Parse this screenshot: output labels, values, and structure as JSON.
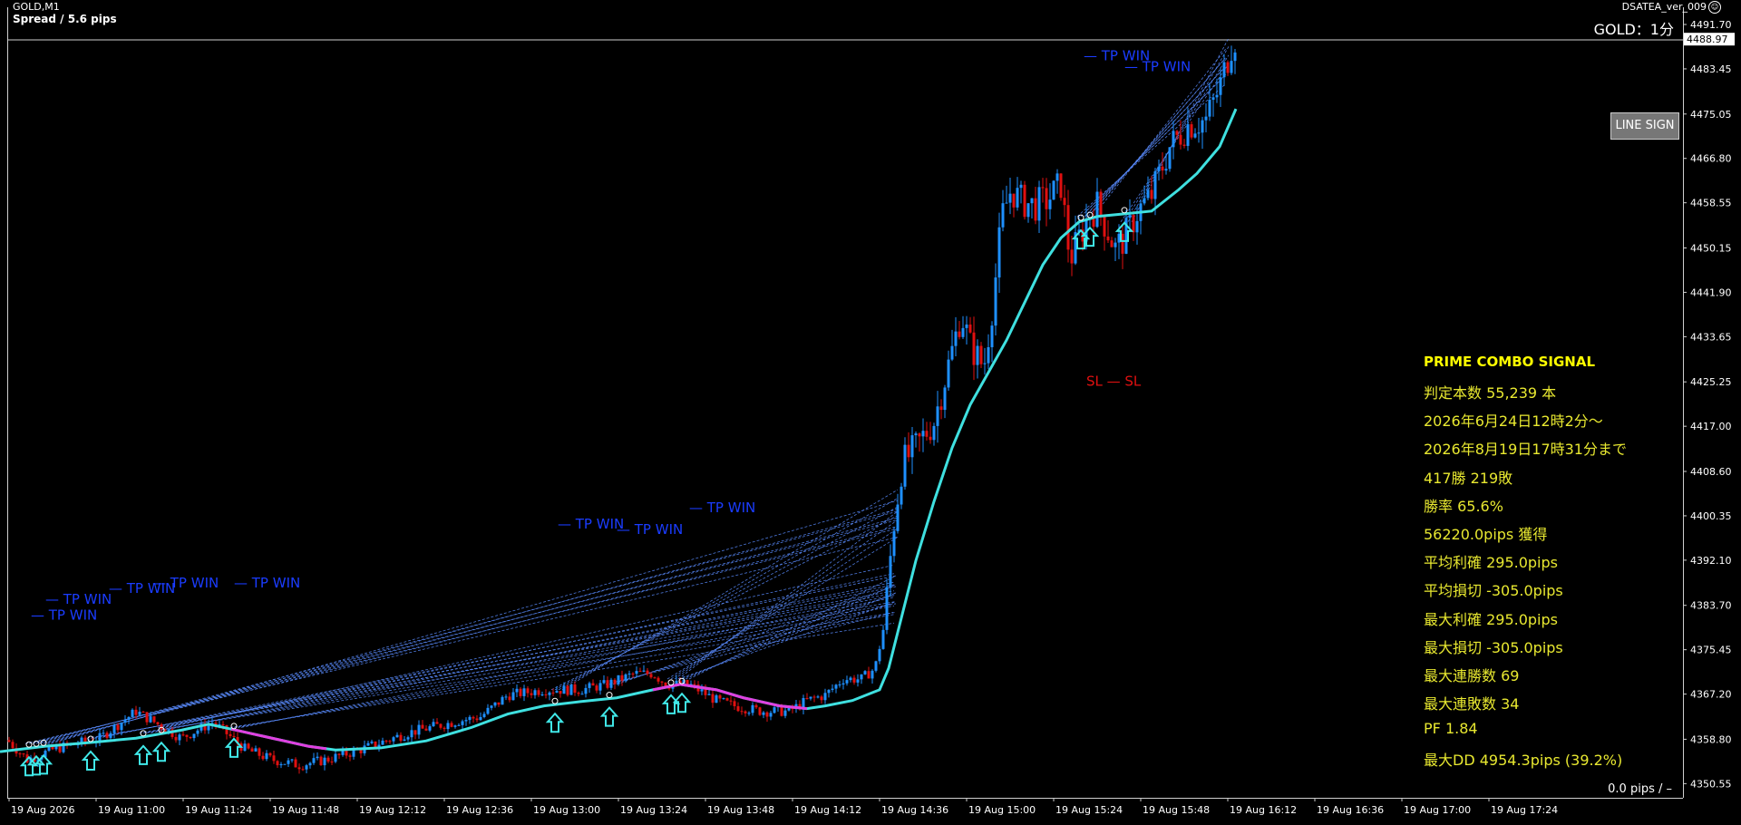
{
  "header": {
    "symbol": "GOLD,M1",
    "spread": "Spread / 5.6 pips",
    "ea_name": "DSATEA_ver_009",
    "ea_face": "☺",
    "chart_label": "GOLD：1分"
  },
  "buttons": {
    "line_sign": "LINE SIGN"
  },
  "stats": {
    "title": "PRIME COMBO SIGNAL",
    "lines": [
      "判定本数 55,239 本",
      "2026年6月24日12時2分～",
      "2026年8月19日17時31分まで",
      "417勝 219敗",
      "勝率 65.6%",
      "56220.0pips 獲得",
      "平均利確 295.0pips",
      "平均損切 -305.0pips",
      "最大利確 295.0pips",
      "最大損切 -305.0pips",
      "最大連勝数 69",
      "最大連敗数 34",
      "PF 1.84",
      "最大DD 4954.3pips (39.2%)"
    ]
  },
  "footer": {
    "pips": "0.0 pips  /  –"
  },
  "annotations": {
    "tp_win": "— TP WIN",
    "sl": "SL — SL"
  },
  "colors": {
    "background": "#000000",
    "bull_candle": "#1e90ff",
    "bear_candle": "#e01010",
    "ma_main": "#3fe0e0",
    "ma_down": "#e040e0",
    "tp_text": "#1a3cff",
    "sl_text": "#e01010",
    "stats_text": "#e8e830",
    "arrow": "#40e8e8"
  },
  "chart_data": {
    "type": "candlestick",
    "symbol": "GOLD",
    "timeframe": "M1",
    "current_price": "4488.97",
    "ylim": [
      4350.95,
      4491.7
    ],
    "y_ticks": [
      "4491.70",
      "4483.45",
      "4475.05",
      "4466.80",
      "4458.55",
      "4450.15",
      "4441.90",
      "4433.65",
      "4425.25",
      "4417.00",
      "4408.60",
      "4400.35",
      "4392.10",
      "4383.70",
      "4375.45",
      "4367.20",
      "4358.80",
      "4350.55"
    ],
    "x_ticks": [
      "19 Aug 2026",
      "19 Aug 11:00",
      "19 Aug 11:24",
      "19 Aug 11:48",
      "19 Aug 12:12",
      "19 Aug 12:36",
      "19 Aug 13:00",
      "19 Aug 13:24",
      "19 Aug 13:48",
      "19 Aug 14:12",
      "19 Aug 14:36",
      "19 Aug 15:00",
      "19 Aug 15:24",
      "19 Aug 15:48",
      "19 Aug 16:12",
      "19 Aug 16:36",
      "19 Aug 17:00",
      "19 Aug 17:24"
    ],
    "price_path": [
      [
        0,
        4360
      ],
      [
        30,
        4355
      ],
      [
        60,
        4357
      ],
      [
        110,
        4359
      ],
      [
        150,
        4364
      ],
      [
        200,
        4359
      ],
      [
        235,
        4362
      ],
      [
        270,
        4357
      ],
      [
        300,
        4355
      ],
      [
        330,
        4354
      ],
      [
        360,
        4355
      ],
      [
        400,
        4357
      ],
      [
        450,
        4360
      ],
      [
        500,
        4362
      ],
      [
        530,
        4363
      ],
      [
        560,
        4367
      ],
      [
        600,
        4368
      ],
      [
        640,
        4368
      ],
      [
        670,
        4369
      ],
      [
        700,
        4371
      ],
      [
        720,
        4371
      ],
      [
        735,
        4369
      ],
      [
        760,
        4369
      ],
      [
        790,
        4366
      ],
      [
        810,
        4365
      ],
      [
        840,
        4364
      ],
      [
        870,
        4364
      ],
      [
        890,
        4366
      ],
      [
        910,
        4367
      ],
      [
        930,
        4370
      ],
      [
        950,
        4370
      ],
      [
        965,
        4372
      ],
      [
        975,
        4380
      ],
      [
        985,
        4398
      ],
      [
        995,
        4410
      ],
      [
        1010,
        4413
      ],
      [
        1030,
        4418
      ],
      [
        1050,
        4431
      ],
      [
        1060,
        4438
      ],
      [
        1070,
        4432
      ],
      [
        1085,
        4428
      ],
      [
        1095,
        4440
      ],
      [
        1105,
        4456
      ],
      [
        1115,
        4461
      ],
      [
        1125,
        4459
      ],
      [
        1140,
        4458
      ],
      [
        1155,
        4459
      ],
      [
        1170,
        4462
      ],
      [
        1180,
        4448
      ],
      [
        1190,
        4452
      ],
      [
        1200,
        4456
      ],
      [
        1210,
        4458
      ],
      [
        1220,
        4454
      ],
      [
        1230,
        4450
      ],
      [
        1240,
        4452
      ],
      [
        1255,
        4457
      ],
      [
        1270,
        4460
      ],
      [
        1290,
        4469
      ],
      [
        1310,
        4473
      ],
      [
        1330,
        4474
      ],
      [
        1345,
        4480
      ],
      [
        1360,
        4489
      ]
    ],
    "ma_path": [
      [
        0,
        4356.5
      ],
      [
        50,
        4357.5
      ],
      [
        100,
        4358.2
      ],
      [
        150,
        4359
      ],
      [
        200,
        4360.5
      ],
      [
        230,
        4361.6
      ],
      [
        260,
        4360.5
      ],
      [
        300,
        4359
      ],
      [
        340,
        4357.5
      ],
      [
        370,
        4356.8
      ],
      [
        420,
        4357.2
      ],
      [
        470,
        4358.5
      ],
      [
        520,
        4361
      ],
      [
        560,
        4363.5
      ],
      [
        600,
        4365
      ],
      [
        640,
        4365.8
      ],
      [
        680,
        4366.5
      ],
      [
        720,
        4368
      ],
      [
        750,
        4369
      ],
      [
        790,
        4368
      ],
      [
        820,
        4366.5
      ],
      [
        860,
        4365
      ],
      [
        890,
        4364.5
      ],
      [
        910,
        4365
      ],
      [
        940,
        4366
      ],
      [
        970,
        4368
      ],
      [
        980,
        4372
      ],
      [
        995,
        4382
      ],
      [
        1010,
        4392
      ],
      [
        1030,
        4403
      ],
      [
        1050,
        4413
      ],
      [
        1070,
        4421
      ],
      [
        1090,
        4427
      ],
      [
        1110,
        4433
      ],
      [
        1130,
        4440
      ],
      [
        1150,
        4447
      ],
      [
        1170,
        4452
      ],
      [
        1190,
        4455
      ],
      [
        1210,
        4456
      ],
      [
        1240,
        4456.5
      ],
      [
        1270,
        4457
      ],
      [
        1300,
        4461
      ],
      [
        1320,
        4464
      ],
      [
        1345,
        4469
      ],
      [
        1363,
        4476
      ]
    ],
    "ma_down_ranges": [
      [
        255,
        360
      ],
      [
        720,
        890
      ]
    ],
    "buy_arrow_x": [
      32,
      40,
      48,
      100,
      158,
      178,
      258,
      612,
      672,
      740,
      752,
      1192,
      1202,
      1240
    ],
    "tp_win_labels": [
      {
        "x": 34,
        "price": 4381
      },
      {
        "x": 50,
        "price": 4384
      },
      {
        "x": 120,
        "price": 4386
      },
      {
        "x": 168,
        "price": 4387
      },
      {
        "x": 258,
        "price": 4387
      },
      {
        "x": 615,
        "price": 4398
      },
      {
        "x": 680,
        "price": 4397
      },
      {
        "x": 760,
        "price": 4401
      },
      {
        "x": 1195,
        "price": 4485
      },
      {
        "x": 1240,
        "price": 4483
      }
    ],
    "sl_labels": [
      {
        "x": 1198,
        "price": 4424.5
      }
    ],
    "trade_lines_from": [
      [
        32,
        4358
      ],
      [
        48,
        4358
      ],
      [
        100,
        4359
      ],
      [
        158,
        4360
      ],
      [
        178,
        4361
      ],
      [
        258,
        4361
      ],
      [
        612,
        4368
      ],
      [
        672,
        4369
      ],
      [
        740,
        4370
      ],
      [
        752,
        4370
      ],
      [
        1192,
        4456
      ],
      [
        1202,
        4457
      ],
      [
        1240,
        4455
      ]
    ],
    "trade_lines_to": [
      [
        990,
        4398
      ],
      [
        990,
        4400
      ],
      [
        988,
        4386
      ],
      [
        988,
        4384
      ],
      [
        986,
        4388
      ],
      [
        986,
        4382
      ],
      [
        990,
        4402
      ],
      [
        985,
        4384
      ],
      [
        990,
        4398
      ],
      [
        988,
        4386
      ],
      [
        1350,
        4482
      ],
      [
        1352,
        4484
      ],
      [
        1355,
        4486
      ]
    ]
  }
}
